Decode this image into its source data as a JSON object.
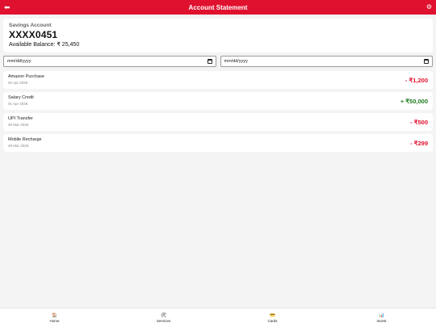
{
  "header": {
    "title": "Account Statement",
    "back_icon": "back-icon",
    "settings_icon": "gear-icon"
  },
  "account": {
    "type": "Savings Account",
    "number": "XXXX0451",
    "balance": "Available Balance: ₹ 25,450"
  },
  "filters": {
    "from_placeholder": "mm/dd/yyyy",
    "to_placeholder": "mm/dd/yyyy"
  },
  "transactions": [
    {
      "name": "Amazon Purchase",
      "date": "02 Apr 2026",
      "amount": "- ₹1,200",
      "kind": "debit"
    },
    {
      "name": "Salary Credit",
      "date": "01 Apr 2026",
      "amount": "+ ₹50,000",
      "kind": "credit"
    },
    {
      "name": "UPI Transfer",
      "date": "30 Mar 2026",
      "amount": "- ₹500",
      "kind": "debit"
    },
    {
      "name": "Mobile Recharge",
      "date": "29 Mar 2026",
      "amount": "- ₹299",
      "kind": "debit"
    }
  ],
  "nav": {
    "home": "Home",
    "services": "Services",
    "cards": "Cards",
    "invest": "Invest"
  },
  "colors": {
    "brand": "#e0112e",
    "debit": "#e0112e",
    "credit": "#1f7a1f"
  }
}
